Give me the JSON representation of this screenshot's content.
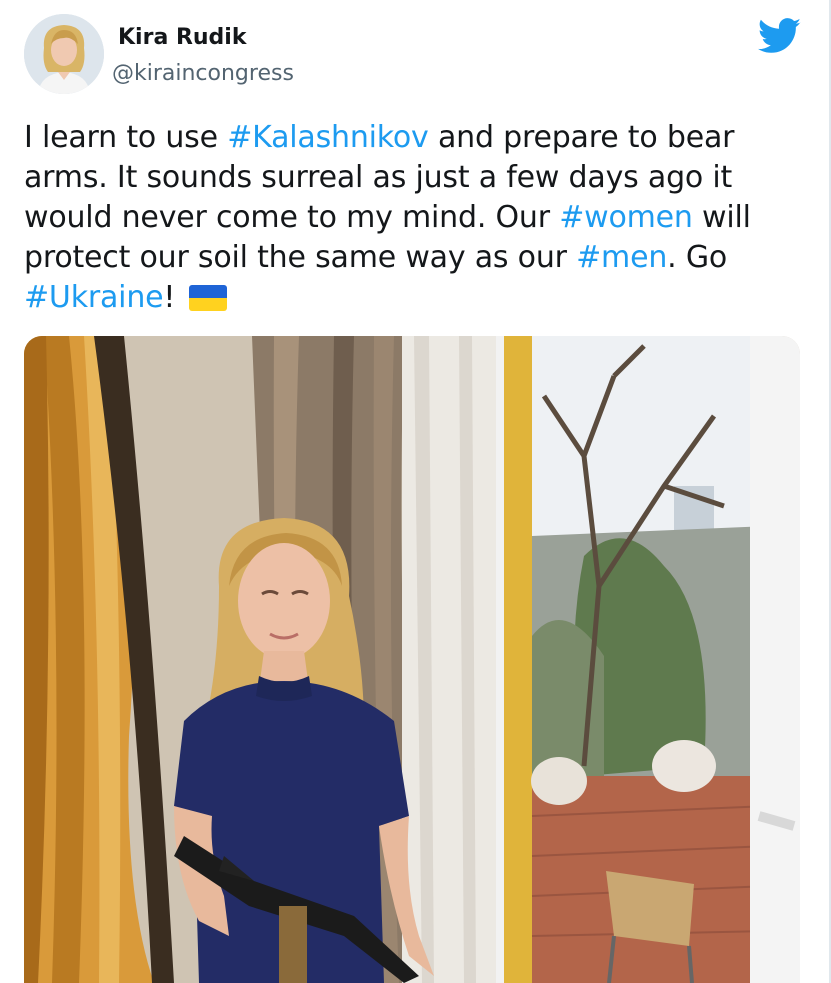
{
  "author": {
    "name": "Kira Rudik",
    "handle": "@kiraincongress",
    "avatar_icon": "profile-photo-avatar"
  },
  "brand": {
    "icon": "twitter-bird-icon",
    "color": "#1d9bf0"
  },
  "tweet": {
    "text_1": "I learn to use ",
    "tag_1": "#Kalashnikov",
    "text_2": " and prepare to bear arms. It sounds surreal as just a few days ago it would never come to my mind. Our ",
    "tag_2": "#women",
    "text_3": " will protect our soil the same way as our ",
    "tag_3": "#men",
    "text_4": ". Go ",
    "tag_4": "#Ukraine",
    "text_5": "!",
    "flag_icon": "ukraine-flag-emoji",
    "flag_colors": [
      "#1f64d6",
      "#ffd21f"
    ]
  },
  "media": {
    "icon": "photo-attachment-image"
  },
  "colors": {
    "hashtag": "#1d9bf0",
    "text": "#14171a",
    "handle": "#536471"
  }
}
